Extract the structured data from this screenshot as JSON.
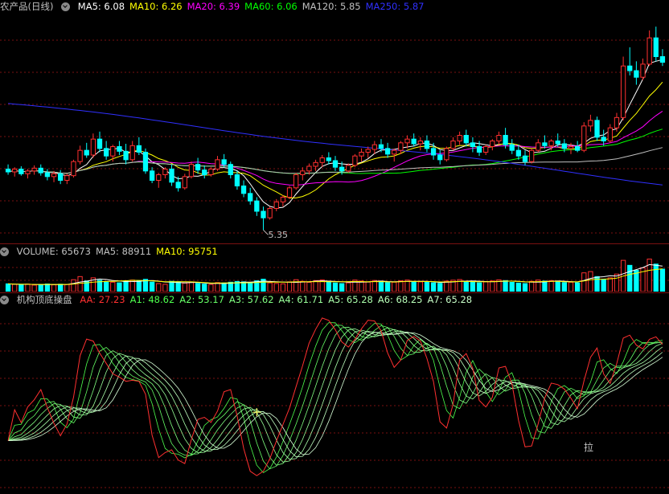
{
  "price_header": {
    "title": "农产品(日线)",
    "items": [
      {
        "label": "MA5: 6.08",
        "color": "#ffffff"
      },
      {
        "label": "MA10: 6.26",
        "color": "#ffff00"
      },
      {
        "label": "MA20: 6.39",
        "color": "#ff00ff"
      },
      {
        "label": "MA60: 6.06",
        "color": "#00ff00"
      },
      {
        "label": "MA120: 5.85",
        "color": "#c0c0c0"
      },
      {
        "label": "MA250: 5.87",
        "color": "#3030ff"
      }
    ]
  },
  "low_label": "5.35",
  "volume_header": {
    "items": [
      {
        "label": "VOLUME: 65673",
        "color": "#c0c0c0"
      },
      {
        "label": "MA5: 88911",
        "color": "#c0c0c0"
      },
      {
        "label": "MA10: 95751",
        "color": "#ffff00"
      }
    ]
  },
  "indicator_header": {
    "title": "机构顶底操盘",
    "items": [
      {
        "label": "AA: 27.23",
        "color": "#ff3030"
      },
      {
        "label": "A1: 48.62",
        "color": "#4dff4d"
      },
      {
        "label": "A2: 53.17",
        "color": "#66ff66"
      },
      {
        "label": "A3: 57.62",
        "color": "#80ff80"
      },
      {
        "label": "A4: 61.71",
        "color": "#99ff99"
      },
      {
        "label": "A5: 65.28",
        "color": "#aaffaa"
      },
      {
        "label": "A6: 68.25",
        "color": "#b8ffb8"
      },
      {
        "label": "A7: 65.28",
        "color": "#c8ffc8"
      }
    ]
  },
  "indicator_note": "拉",
  "colors": {
    "up": "#ff3030",
    "down": "#00ffff",
    "grid": "#7a1010"
  },
  "chart_data": {
    "type": "candlestick",
    "ohlc": [
      [
        6.0,
        6.05,
        5.94,
        5.97
      ],
      [
        5.97,
        6.02,
        5.92,
        6.0
      ],
      [
        6.0,
        6.03,
        5.93,
        5.95
      ],
      [
        5.95,
        6.0,
        5.9,
        5.98
      ],
      [
        5.98,
        6.04,
        5.94,
        6.01
      ],
      [
        6.01,
        6.05,
        5.93,
        5.96
      ],
      [
        5.96,
        6.0,
        5.88,
        5.92
      ],
      [
        5.92,
        5.98,
        5.86,
        5.95
      ],
      [
        5.95,
        5.99,
        5.84,
        5.88
      ],
      [
        5.88,
        5.95,
        5.84,
        5.93
      ],
      [
        5.93,
        6.1,
        5.91,
        6.08
      ],
      [
        6.08,
        6.25,
        6.05,
        6.2
      ],
      [
        6.2,
        6.28,
        6.12,
        6.15
      ],
      [
        6.15,
        6.38,
        6.12,
        6.32
      ],
      [
        6.32,
        6.4,
        6.18,
        6.22
      ],
      [
        6.22,
        6.3,
        6.1,
        6.14
      ],
      [
        6.14,
        6.26,
        6.08,
        6.24
      ],
      [
        6.24,
        6.3,
        6.15,
        6.19
      ],
      [
        6.19,
        6.27,
        6.05,
        6.1
      ],
      [
        6.1,
        6.3,
        6.08,
        6.25
      ],
      [
        6.25,
        6.34,
        6.15,
        6.18
      ],
      [
        6.18,
        6.22,
        5.95,
        5.98
      ],
      [
        5.98,
        6.02,
        5.85,
        5.88
      ],
      [
        5.88,
        5.96,
        5.8,
        5.94
      ],
      [
        5.94,
        6.02,
        5.9,
        6.0
      ],
      [
        6.0,
        6.05,
        5.82,
        5.86
      ],
      [
        5.86,
        5.92,
        5.76,
        5.8
      ],
      [
        5.8,
        5.95,
        5.78,
        5.92
      ],
      [
        5.92,
        6.08,
        5.9,
        6.05
      ],
      [
        6.05,
        6.12,
        5.95,
        5.99
      ],
      [
        5.99,
        6.04,
        5.9,
        5.94
      ],
      [
        5.94,
        6.02,
        5.92,
        6.0
      ],
      [
        6.0,
        6.14,
        5.98,
        6.1
      ],
      [
        6.1,
        6.16,
        6.02,
        6.05
      ],
      [
        6.05,
        6.08,
        5.9,
        5.94
      ],
      [
        5.94,
        5.98,
        5.78,
        5.82
      ],
      [
        5.82,
        5.88,
        5.7,
        5.74
      ],
      [
        5.74,
        5.8,
        5.62,
        5.66
      ],
      [
        5.66,
        5.7,
        5.5,
        5.55
      ],
      [
        5.55,
        5.6,
        5.35,
        5.48
      ],
      [
        5.48,
        5.6,
        5.46,
        5.58
      ],
      [
        5.58,
        5.68,
        5.55,
        5.65
      ],
      [
        5.65,
        5.72,
        5.6,
        5.7
      ],
      [
        5.7,
        5.82,
        5.68,
        5.8
      ],
      [
        5.8,
        5.96,
        5.78,
        5.94
      ],
      [
        5.94,
        6.02,
        5.88,
        5.98
      ],
      [
        5.98,
        6.06,
        5.94,
        6.03
      ],
      [
        6.03,
        6.1,
        5.98,
        6.07
      ],
      [
        6.07,
        6.15,
        6.02,
        6.12
      ],
      [
        6.12,
        6.18,
        6.05,
        6.09
      ],
      [
        6.09,
        6.14,
        5.98,
        6.02
      ],
      [
        6.02,
        6.08,
        5.94,
        5.98
      ],
      [
        5.98,
        6.06,
        5.96,
        6.04
      ],
      [
        6.04,
        6.16,
        6.02,
        6.14
      ],
      [
        6.14,
        6.22,
        6.08,
        6.18
      ],
      [
        6.18,
        6.24,
        6.12,
        6.21
      ],
      [
        6.21,
        6.3,
        6.16,
        6.26
      ],
      [
        6.26,
        6.32,
        6.18,
        6.22
      ],
      [
        6.22,
        6.28,
        6.12,
        6.16
      ],
      [
        6.16,
        6.22,
        6.08,
        6.2
      ],
      [
        6.2,
        6.3,
        6.16,
        6.28
      ],
      [
        6.28,
        6.36,
        6.22,
        6.32
      ],
      [
        6.32,
        6.38,
        6.24,
        6.27
      ],
      [
        6.27,
        6.34,
        6.2,
        6.3
      ],
      [
        6.3,
        6.36,
        6.18,
        6.22
      ],
      [
        6.22,
        6.28,
        6.1,
        6.15
      ],
      [
        6.15,
        6.2,
        6.05,
        6.1
      ],
      [
        6.1,
        6.24,
        6.08,
        6.22
      ],
      [
        6.22,
        6.34,
        6.2,
        6.3
      ],
      [
        6.3,
        6.4,
        6.26,
        6.36
      ],
      [
        6.36,
        6.42,
        6.24,
        6.28
      ],
      [
        6.28,
        6.34,
        6.18,
        6.24
      ],
      [
        6.24,
        6.3,
        6.14,
        6.18
      ],
      [
        6.18,
        6.26,
        6.15,
        6.24
      ],
      [
        6.24,
        6.32,
        6.2,
        6.3
      ],
      [
        6.3,
        6.4,
        6.26,
        6.36
      ],
      [
        6.36,
        6.44,
        6.22,
        6.26
      ],
      [
        6.26,
        6.32,
        6.16,
        6.2
      ],
      [
        6.2,
        6.26,
        6.1,
        6.14
      ],
      [
        6.14,
        6.2,
        6.04,
        6.08
      ],
      [
        6.08,
        6.22,
        6.06,
        6.2
      ],
      [
        6.2,
        6.32,
        6.18,
        6.28
      ],
      [
        6.28,
        6.36,
        6.22,
        6.25
      ],
      [
        6.25,
        6.32,
        6.2,
        6.3
      ],
      [
        6.3,
        6.38,
        6.24,
        6.27
      ],
      [
        6.27,
        6.32,
        6.18,
        6.22
      ],
      [
        6.22,
        6.28,
        6.16,
        6.24
      ],
      [
        6.24,
        6.3,
        6.18,
        6.2
      ],
      [
        6.2,
        6.5,
        6.18,
        6.46
      ],
      [
        6.46,
        6.58,
        6.4,
        6.52
      ],
      [
        6.52,
        6.56,
        6.3,
        6.34
      ],
      [
        6.34,
        6.42,
        6.25,
        6.3
      ],
      [
        6.3,
        6.48,
        6.28,
        6.44
      ],
      [
        6.44,
        6.6,
        6.4,
        6.55
      ],
      [
        6.55,
        7.2,
        6.52,
        7.1
      ],
      [
        7.1,
        7.3,
        7.0,
        7.05
      ],
      [
        7.05,
        7.15,
        6.9,
        6.98
      ],
      [
        6.98,
        7.18,
        6.95,
        7.12
      ],
      [
        7.12,
        7.48,
        7.1,
        7.4
      ],
      [
        7.4,
        7.52,
        7.15,
        7.2
      ],
      [
        7.2,
        7.28,
        7.1,
        7.14
      ]
    ],
    "volume": [
      62000,
      58000,
      55000,
      60000,
      52000,
      57000,
      61000,
      54000,
      59000,
      56000,
      95000,
      120000,
      85000,
      110000,
      90000,
      80000,
      75000,
      70000,
      85000,
      92000,
      88000,
      98000,
      76000,
      64000,
      58000,
      82000,
      79000,
      68000,
      74000,
      66000,
      60000,
      57000,
      72000,
      69000,
      75000,
      81000,
      78000,
      73000,
      86000,
      99000,
      70000,
      65000,
      62000,
      78000,
      95000,
      82000,
      74000,
      88000,
      93000,
      81000,
      69000,
      64000,
      70000,
      92000,
      84000,
      76000,
      89000,
      80000,
      72000,
      75000,
      86000,
      92000,
      80000,
      78000,
      74000,
      70000,
      66000,
      84000,
      91000,
      96000,
      82000,
      76000,
      70000,
      78000,
      85000,
      94000,
      88000,
      74000,
      68000,
      64000,
      82000,
      92000,
      84000,
      88000,
      80000,
      72000,
      75000,
      70000,
      150000,
      160000,
      120000,
      95000,
      110000,
      140000,
      250000,
      210000,
      170000,
      190000,
      260000,
      220000,
      180000
    ],
    "ma5": 6.08,
    "ma10": 6.26,
    "ma20": 6.39,
    "ma60": 6.06,
    "ma120": 5.85,
    "ma250": 5.87,
    "indicator": {
      "AA": 27.23,
      "A1": 48.62,
      "A2": 53.17,
      "A3": 57.62,
      "A4": 61.71,
      "A5": 65.28,
      "A6": 68.25,
      "A7": 65.28
    },
    "low_marker": 5.35
  }
}
